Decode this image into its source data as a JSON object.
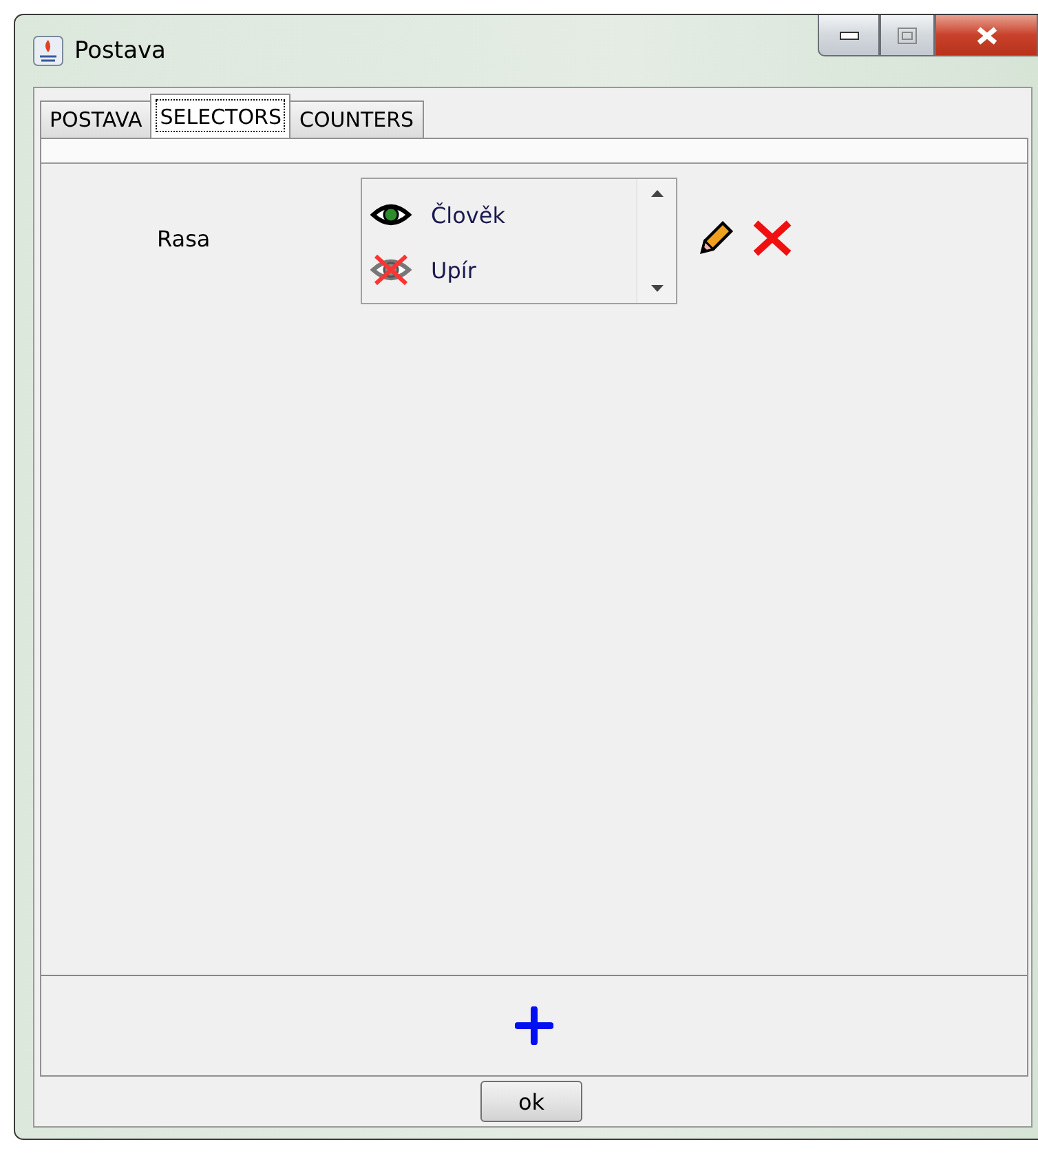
{
  "window": {
    "title": "Postava"
  },
  "tabs": [
    {
      "label": "POSTAVA",
      "selected": false
    },
    {
      "label": "SELECTORS",
      "selected": true
    },
    {
      "label": "COUNTERS",
      "selected": false
    }
  ],
  "selectors": [
    {
      "label": "Rasa",
      "options": [
        {
          "label": "Člověk",
          "visible": true
        },
        {
          "label": "Upír",
          "visible": false
        }
      ]
    }
  ],
  "buttons": {
    "ok": "ok"
  }
}
